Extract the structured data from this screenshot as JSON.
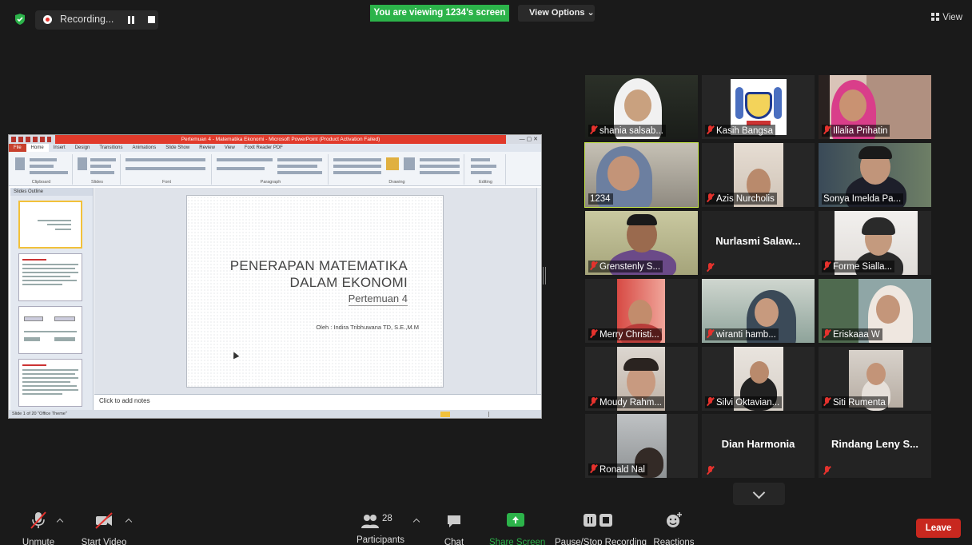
{
  "top_bar": {
    "recording_label": "Recording...",
    "viewing_banner": "You are viewing 1234’s screen",
    "view_options_label": "View Options ⌄",
    "view_label": "View"
  },
  "shared_screen": {
    "window_title": "Pertemuan 4 - Matematika Ekonomi - Microsoft PowerPoint (Product Activation Failed)",
    "ribbon_tabs": [
      "File",
      "Home",
      "Insert",
      "Design",
      "Transitions",
      "Animations",
      "Slide Show",
      "Review",
      "View",
      "Foxit Reader PDF"
    ],
    "ribbon_groups": [
      "Clipboard",
      "Slides",
      "Font",
      "Paragraph",
      "Drawing",
      "Editing"
    ],
    "panel_tabs": "Slides    Outline",
    "slide": {
      "title_line1": "PENERAPAN MATEMATIKA",
      "title_line2": "DALAM EKONOMI",
      "subtitle": "Pertemuan 4",
      "author": "Oleh : Indira Tribhuwana TD, S.E.,M.M"
    },
    "notes_placeholder": "Click to add notes",
    "status_text": "Slide 1 of 20   \"Office Theme\""
  },
  "participants_grid": [
    {
      "name": "shania salsab...",
      "muted": true
    },
    {
      "name": "Kasih Bangsa",
      "muted": true
    },
    {
      "name": "Illalia Prihatin",
      "muted": true
    },
    {
      "name": "1234",
      "muted": false,
      "active_speaker": true
    },
    {
      "name": "Azis Nurcholis",
      "muted": true
    },
    {
      "name": "Sonya Imelda Pa...",
      "muted": false
    },
    {
      "name": "Grenstenly S...",
      "muted": true
    },
    {
      "name": "Nurlasmi  Salaw...",
      "muted": true,
      "video_off": true
    },
    {
      "name": "Forme Sialla...",
      "muted": true
    },
    {
      "name": "Merry Christi...",
      "muted": true
    },
    {
      "name": "wiranti hamb...",
      "muted": true
    },
    {
      "name": "Eriskaaa W",
      "muted": true
    },
    {
      "name": "Moudy Rahm...",
      "muted": true
    },
    {
      "name": "Silvi Oktavian...",
      "muted": true
    },
    {
      "name": "Siti Rumenta",
      "muted": true
    },
    {
      "name": "Ronald Nal",
      "muted": true
    },
    {
      "name": "Dian Harmonia",
      "muted": true,
      "video_off": true
    },
    {
      "name": "Rindang Leny S...",
      "muted": true,
      "video_off": true
    }
  ],
  "toolbar": {
    "unmute": "Unmute",
    "start_video": "Start Video",
    "participants_count": "28",
    "participants": "Participants",
    "chat": "Chat",
    "share_screen": "Share Screen",
    "pause_stop_recording": "Pause/Stop Recording",
    "reactions": "Reactions",
    "leave": "Leave"
  },
  "colors": {
    "zoom_green": "#2cb34a",
    "leave_red": "#c8281f",
    "active_speaker": "#c8e84b",
    "muted_red": "#e5322d"
  }
}
